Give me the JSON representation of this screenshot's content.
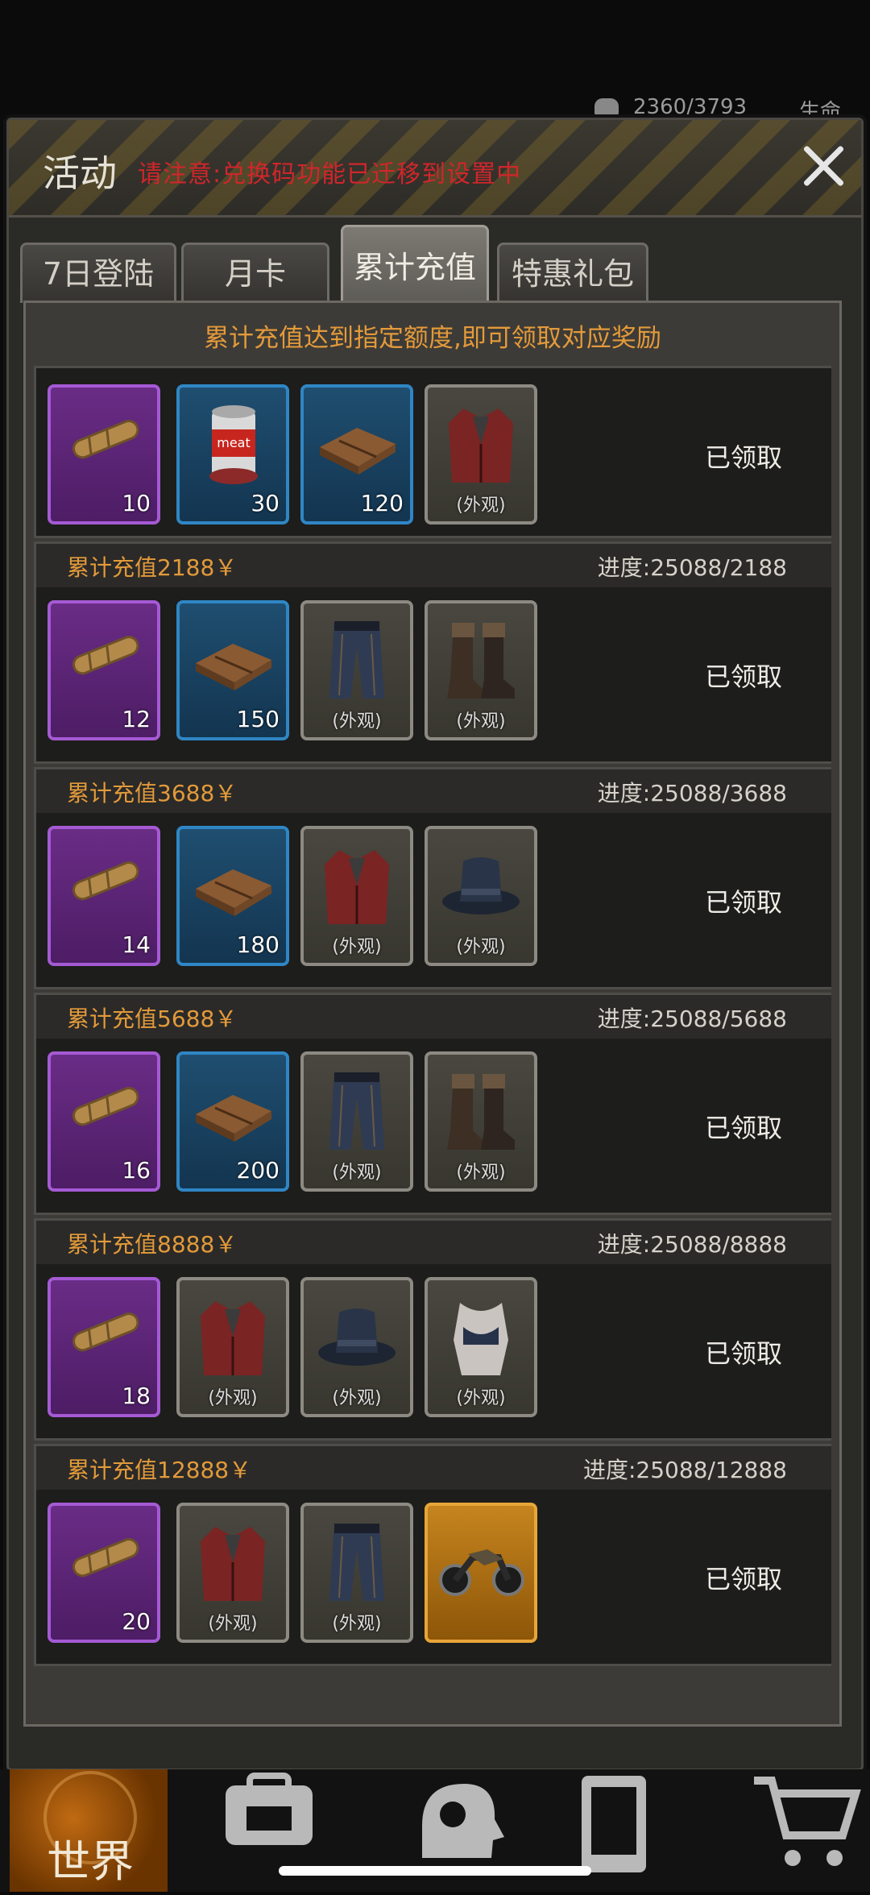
{
  "status": {
    "hp": "2360/3793",
    "life_label": "生命"
  },
  "header": {
    "title": "活动",
    "notice": "请注意:兑换码功能已迁移到设置中"
  },
  "tabs": [
    {
      "label": "7日登陆"
    },
    {
      "label": "月卡"
    },
    {
      "label": "累计充值"
    },
    {
      "label": "特惠礼包"
    }
  ],
  "active_tab": 2,
  "panel_hint": "累计充值达到指定额度,即可领取对应奖励",
  "skin_label": "(外观)",
  "rows": [
    {
      "title": "",
      "progress": "",
      "status": "已领取",
      "items": [
        {
          "kind": "cigar",
          "rarity": "purple",
          "qty": "10"
        },
        {
          "kind": "meat-can",
          "rarity": "blue",
          "qty": "30"
        },
        {
          "kind": "wood-box",
          "rarity": "blue",
          "qty": "120"
        },
        {
          "kind": "coat",
          "rarity": "grey",
          "skin": true
        }
      ]
    },
    {
      "title": "累计充值2188￥",
      "progress": "进度:25088/2188",
      "status": "已领取",
      "items": [
        {
          "kind": "cigar",
          "rarity": "purple",
          "qty": "12"
        },
        {
          "kind": "wood-box",
          "rarity": "blue",
          "qty": "150"
        },
        {
          "kind": "pants",
          "rarity": "grey",
          "skin": true
        },
        {
          "kind": "boots",
          "rarity": "grey",
          "skin": true
        }
      ]
    },
    {
      "title": "累计充值3688￥",
      "progress": "进度:25088/3688",
      "status": "已领取",
      "items": [
        {
          "kind": "cigar",
          "rarity": "purple",
          "qty": "14"
        },
        {
          "kind": "wood-box",
          "rarity": "blue",
          "qty": "180"
        },
        {
          "kind": "coat",
          "rarity": "grey",
          "skin": true
        },
        {
          "kind": "hat",
          "rarity": "grey",
          "skin": true
        }
      ]
    },
    {
      "title": "累计充值5688￥",
      "progress": "进度:25088/5688",
      "status": "已领取",
      "items": [
        {
          "kind": "cigar",
          "rarity": "purple",
          "qty": "16"
        },
        {
          "kind": "wood-box",
          "rarity": "blue",
          "qty": "200"
        },
        {
          "kind": "pants",
          "rarity": "grey",
          "skin": true
        },
        {
          "kind": "boots",
          "rarity": "grey",
          "skin": true
        }
      ]
    },
    {
      "title": "累计充值8888￥",
      "progress": "进度:25088/8888",
      "status": "已领取",
      "items": [
        {
          "kind": "cigar",
          "rarity": "purple",
          "qty": "18"
        },
        {
          "kind": "coat",
          "rarity": "grey",
          "skin": true
        },
        {
          "kind": "hat",
          "rarity": "grey",
          "skin": true
        },
        {
          "kind": "top",
          "rarity": "grey",
          "skin": true
        }
      ]
    },
    {
      "title": "累计充值12888￥",
      "progress": "进度:25088/12888",
      "status": "已领取",
      "items": [
        {
          "kind": "cigar",
          "rarity": "purple",
          "qty": "20"
        },
        {
          "kind": "coat",
          "rarity": "grey",
          "skin": true
        },
        {
          "kind": "pants",
          "rarity": "grey",
          "skin": true
        },
        {
          "kind": "motorcycle",
          "rarity": "gold"
        }
      ]
    }
  ],
  "bottom_nav": {
    "items": [
      {
        "label": "世界",
        "icon": "globe-icon"
      },
      {
        "label": "",
        "icon": "backpack-icon"
      },
      {
        "label": "",
        "icon": "head-gear-icon"
      },
      {
        "label": "",
        "icon": "phone-icon"
      },
      {
        "label": "",
        "icon": "cart-icon"
      }
    ]
  }
}
